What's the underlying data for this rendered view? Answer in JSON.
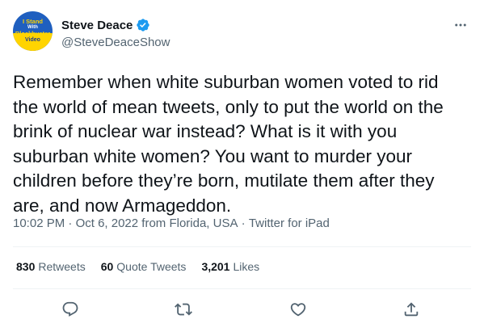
{
  "author": {
    "avatar_text": [
      "I Stand",
      "With",
      "Blockbuster",
      "Video"
    ],
    "display_name": "Steve Deace",
    "handle": "@SteveDeaceShow",
    "verified_icon": "verified-badge-icon"
  },
  "tweet": {
    "text": "Remember when white suburban women voted to rid\nthe world of mean tweets, only to put the world on the\nbrink of nuclear war instead? What is it with you\nsuburban white women? You want to murder your\nchildren before they’re born, mutilate them after they\nare, and now Armageddon.",
    "time": "10:02 PM",
    "sep1": " · ",
    "date": "Oct 6, 2022 from Florida, USA",
    "sep2": " · ",
    "source": "Twitter for iPad"
  },
  "stats": {
    "retweets_count": "830",
    "retweets_label": "Retweets",
    "quotes_count": "60",
    "quotes_label": "Quote Tweets",
    "likes_count": "3,201",
    "likes_label": "Likes"
  },
  "colors": {
    "text": "#0f1419",
    "secondary": "#536471",
    "verified": "#1d9bf0",
    "divider": "#eff3f4"
  }
}
